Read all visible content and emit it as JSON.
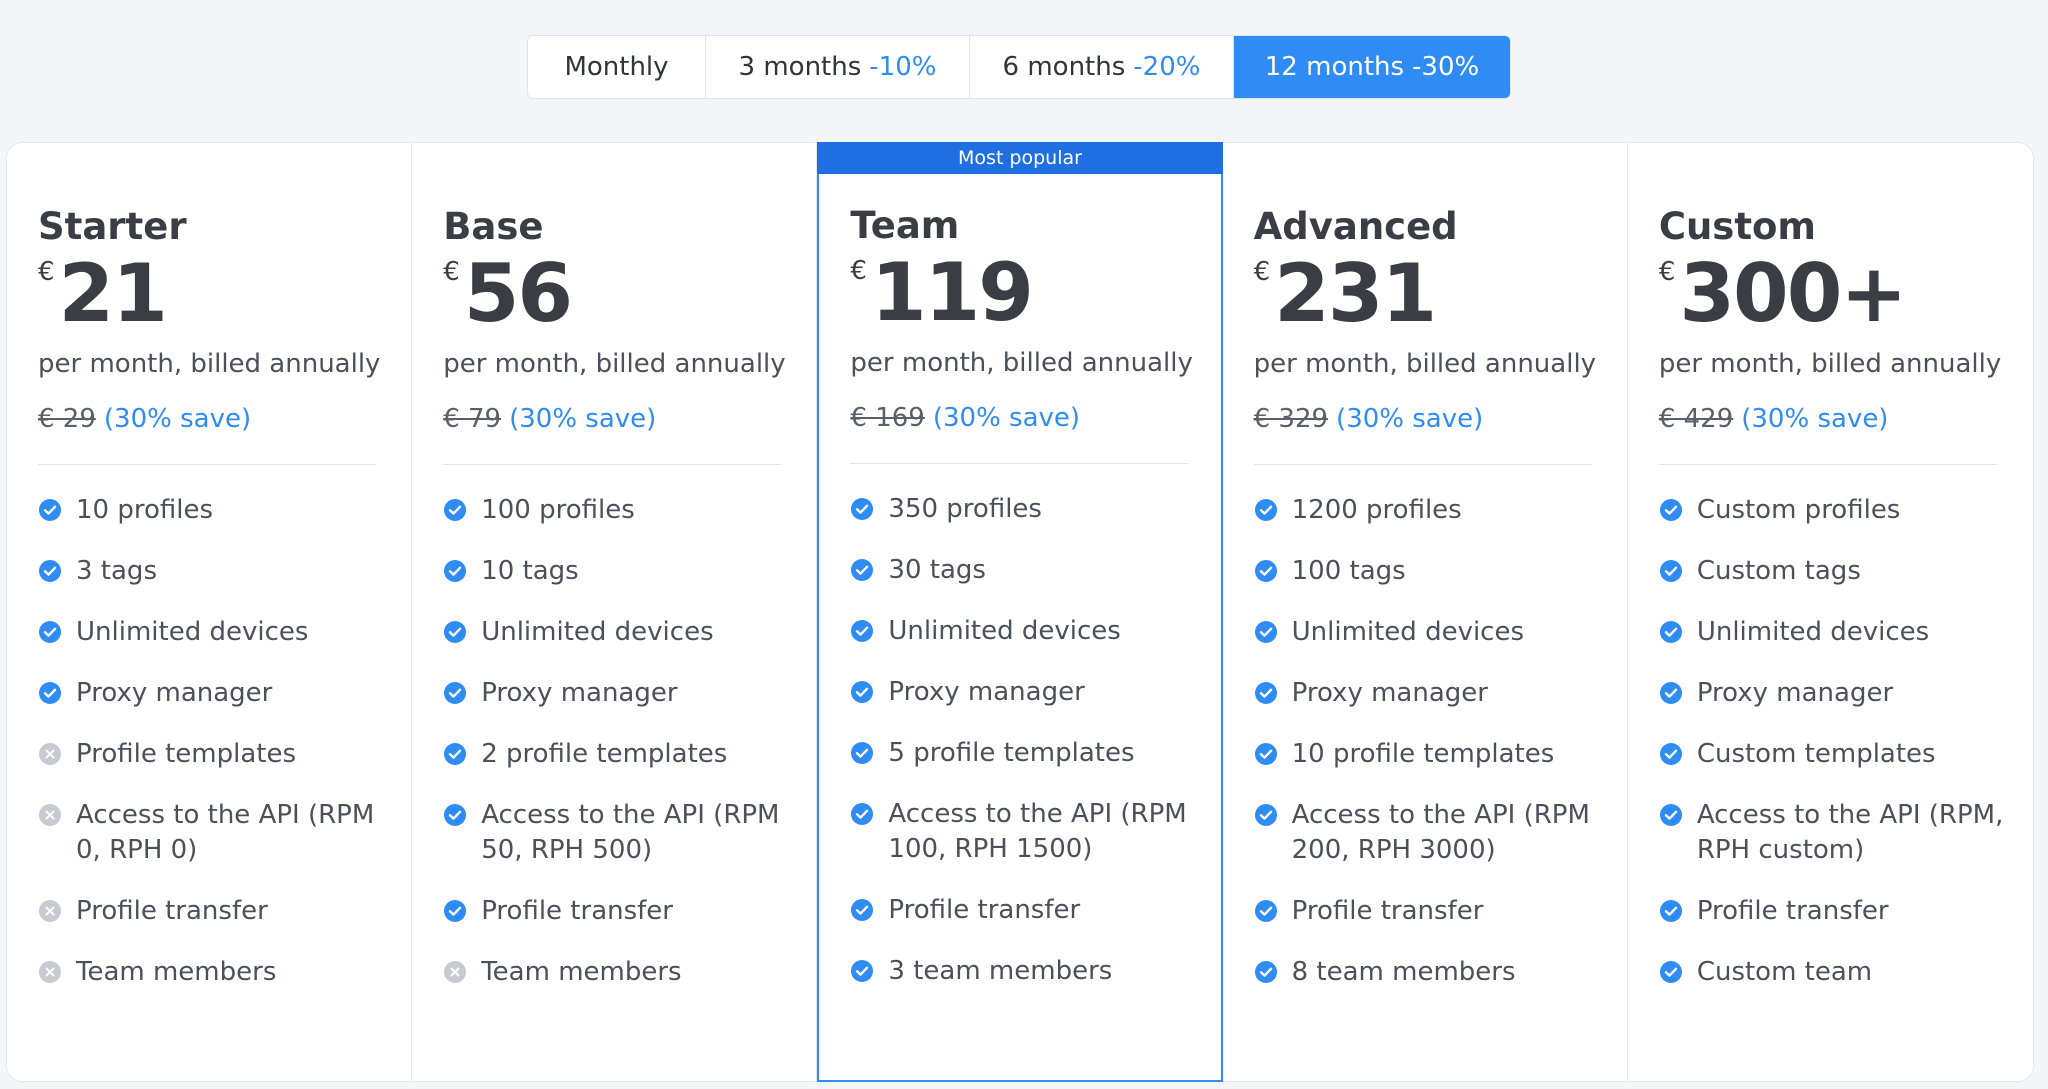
{
  "tabs": [
    {
      "label": "Monthly",
      "discount": "",
      "active": false
    },
    {
      "label": "3 months",
      "discount": "-10%",
      "active": false
    },
    {
      "label": "6 months",
      "discount": "-20%",
      "active": false
    },
    {
      "label": "12 months",
      "discount": "-30%",
      "active": true
    }
  ],
  "colors": {
    "accent": "#2f8cf4",
    "badge": "#1f6fe3",
    "included": "#2f8cf4",
    "excluded": "#c7cad0"
  },
  "plans": [
    {
      "name": "Starter",
      "currency": "€",
      "price": "21",
      "billing": "per month, billed annually",
      "old_price": "€ 29",
      "save": "(30% save)",
      "badge": "",
      "features": [
        {
          "text": "10 profiles",
          "included": true
        },
        {
          "text": "3 tags",
          "included": true
        },
        {
          "text": "Unlimited devices",
          "included": true
        },
        {
          "text": "Proxy manager",
          "included": true
        },
        {
          "text": "Profile templates",
          "included": false
        },
        {
          "text": "Access to the API (RPM 0, RPH 0)",
          "included": false
        },
        {
          "text": "Profile transfer",
          "included": false
        },
        {
          "text": "Team members",
          "included": false
        }
      ]
    },
    {
      "name": "Base",
      "currency": "€",
      "price": "56",
      "billing": "per month, billed annually",
      "old_price": "€ 79",
      "save": "(30% save)",
      "badge": "",
      "features": [
        {
          "text": "100 profiles",
          "included": true
        },
        {
          "text": "10 tags",
          "included": true
        },
        {
          "text": "Unlimited devices",
          "included": true
        },
        {
          "text": "Proxy manager",
          "included": true
        },
        {
          "text": "2 profile templates",
          "included": true
        },
        {
          "text": "Access to the API (RPM 50, RPH 500)",
          "included": true
        },
        {
          "text": "Profile transfer",
          "included": true
        },
        {
          "text": "Team members",
          "included": false
        }
      ]
    },
    {
      "name": "Team",
      "currency": "€",
      "price": "119",
      "billing": "per month, billed annually",
      "old_price": "€ 169",
      "save": "(30% save)",
      "badge": "Most popular",
      "features": [
        {
          "text": "350 profiles",
          "included": true
        },
        {
          "text": "30 tags",
          "included": true
        },
        {
          "text": "Unlimited devices",
          "included": true
        },
        {
          "text": "Proxy manager",
          "included": true
        },
        {
          "text": "5 profile templates",
          "included": true
        },
        {
          "text": "Access to the API (RPM 100, RPH 1500)",
          "included": true
        },
        {
          "text": "Profile transfer",
          "included": true
        },
        {
          "text": "3 team members",
          "included": true
        }
      ]
    },
    {
      "name": "Advanced",
      "currency": "€",
      "price": "231",
      "billing": "per month, billed annually",
      "old_price": "€ 329",
      "save": "(30% save)",
      "badge": "",
      "features": [
        {
          "text": "1200 profiles",
          "included": true
        },
        {
          "text": "100 tags",
          "included": true
        },
        {
          "text": "Unlimited devices",
          "included": true
        },
        {
          "text": "Proxy manager",
          "included": true
        },
        {
          "text": "10 profile templates",
          "included": true
        },
        {
          "text": "Access to the API (RPM 200, RPH 3000)",
          "included": true
        },
        {
          "text": "Profile transfer",
          "included": true
        },
        {
          "text": "8 team members",
          "included": true
        }
      ]
    },
    {
      "name": "Custom",
      "currency": "€",
      "price": "300+",
      "billing": "per month, billed annually",
      "old_price": "€ 429",
      "save": "(30% save)",
      "badge": "",
      "features": [
        {
          "text": "Custom profiles",
          "included": true
        },
        {
          "text": "Custom tags",
          "included": true
        },
        {
          "text": "Unlimited devices",
          "included": true
        },
        {
          "text": "Proxy manager",
          "included": true
        },
        {
          "text": "Custom templates",
          "included": true
        },
        {
          "text": "Access to the API (RPM, RPH custom)",
          "included": true
        },
        {
          "text": "Profile transfer",
          "included": true
        },
        {
          "text": "Custom team",
          "included": true
        }
      ]
    }
  ]
}
